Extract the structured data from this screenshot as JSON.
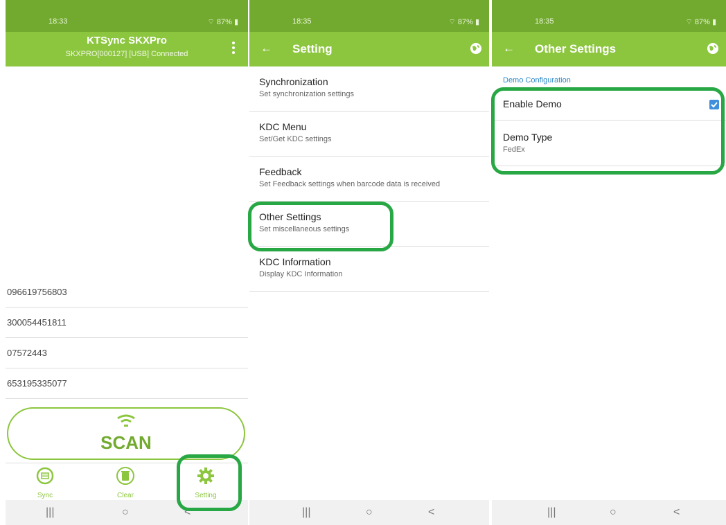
{
  "phone1": {
    "status_time": "18:33",
    "status_signal": "87%",
    "app_title": "KTSync SKXPro",
    "connection_status": "SKXPRO[000127] [USB] Connected",
    "barcodes": [
      "096619756803",
      "300054451811",
      "07572443",
      "653195335077"
    ],
    "scan_label": "SCAN",
    "nav": {
      "sync": "Sync",
      "clear": "Clear",
      "setting": "Setting"
    }
  },
  "phone2": {
    "status_time": "18:35",
    "status_signal": "87%",
    "title": "Setting",
    "items": [
      {
        "title": "Synchronization",
        "subtitle": "Set synchronization settings"
      },
      {
        "title": "KDC Menu",
        "subtitle": "Set/Get KDC settings"
      },
      {
        "title": "Feedback",
        "subtitle": "Set Feedback settings when barcode data is received"
      },
      {
        "title": "Other Settings",
        "subtitle": "Set miscellaneous settings"
      },
      {
        "title": "KDC Information",
        "subtitle": "Display KDC Information"
      }
    ]
  },
  "phone3": {
    "status_time": "18:35",
    "status_signal": "87%",
    "title": "Other Settings",
    "category": "Demo Configuration",
    "enable_demo_label": "Enable Demo",
    "enable_demo_checked": true,
    "demo_type_label": "Demo Type",
    "demo_type_value": "FedEx"
  },
  "system_nav": {
    "recent": "|||",
    "home": "○",
    "back": "<"
  },
  "colors": {
    "appbar": "#8cc63f",
    "statusbar": "#72aa2f",
    "highlight": "#28a745",
    "checkbox": "#3f8fdc"
  }
}
